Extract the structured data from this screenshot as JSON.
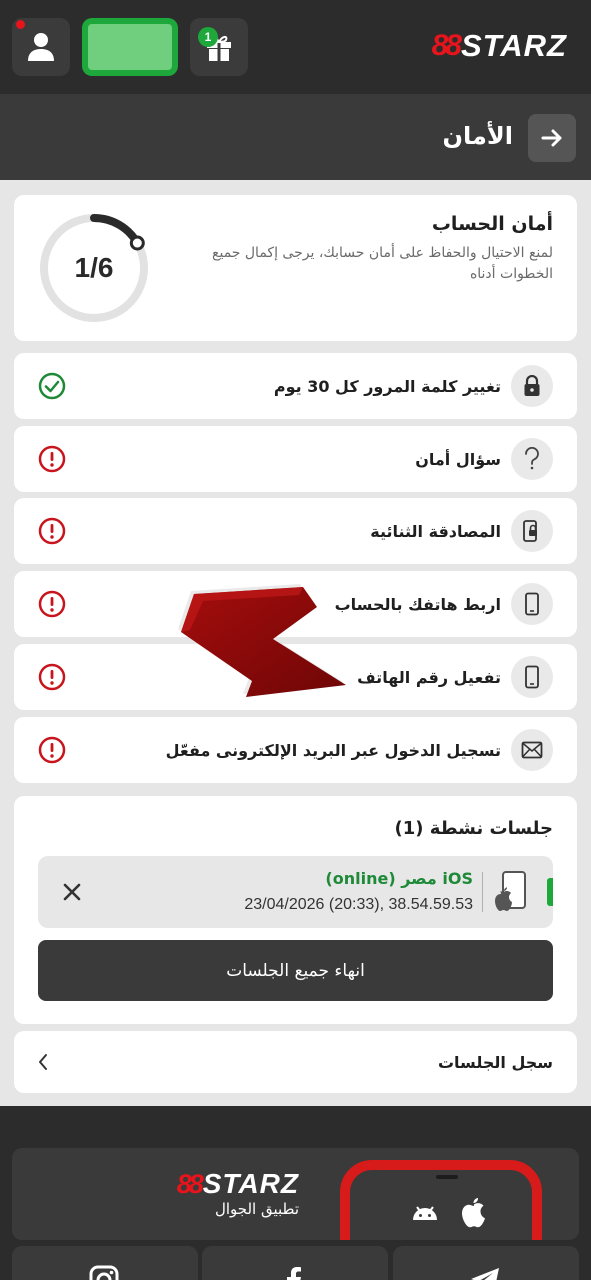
{
  "topbar": {
    "gift_count": "1",
    "logo_mark": "88",
    "logo_text": "STARZ",
    "icons": [
      "user-icon",
      "gift-icon"
    ]
  },
  "header": {
    "title": "الأمان",
    "back_icon": "arrow-right-icon"
  },
  "summary": {
    "progress_text": "1/6",
    "progress_fraction": 0.1667,
    "title": "أمان الحساب",
    "description": "لمنع الاحتيال والحفاظ على أمان حسابك، يرجى إكمال جميع الخطوات أدناه"
  },
  "security_items": [
    {
      "label": "تغيير كلمة المرور كل 30 يوم",
      "icon": "lock-icon",
      "status": "done"
    },
    {
      "label": "سؤال أمان",
      "icon": "question-icon",
      "status": "warning"
    },
    {
      "label": "المصادقة الثنائية",
      "icon": "two-factor-icon",
      "status": "warning"
    },
    {
      "label": "اربط هاتفك بالحساب",
      "icon": "phone-icon",
      "status": "warning"
    },
    {
      "label": "تفعيل رقم الهاتف",
      "icon": "phone-icon",
      "status": "warning"
    },
    {
      "label": "تسجيل الدخول عبر البريد الإلكترونى مفعّل",
      "icon": "envelope-icon",
      "status": "warning"
    }
  ],
  "sessions": {
    "title": "جلسات نشطة (1)",
    "items": [
      {
        "line1": "iOS مصر (online)",
        "line2": "38.54.59.53 ,(20:33) 23/04/2026"
      }
    ],
    "end_all_label": "انهاء جميع الجلسات"
  },
  "history": {
    "label": "سجل الجلسات"
  },
  "footer": {
    "logo_mark": "88",
    "logo_text": "STARZ",
    "app_subtitle": "تطبيق الجوال",
    "os_icons": [
      "android-icon",
      "apple-icon"
    ],
    "social_icons": [
      "instagram-icon",
      "facebook-icon",
      "telegram-icon"
    ]
  },
  "colors": {
    "brand_red": "#e8141c",
    "success_green": "#1ea83c",
    "warning_red": "#c8141c",
    "annotation_arrow": "#8b0a0a"
  }
}
